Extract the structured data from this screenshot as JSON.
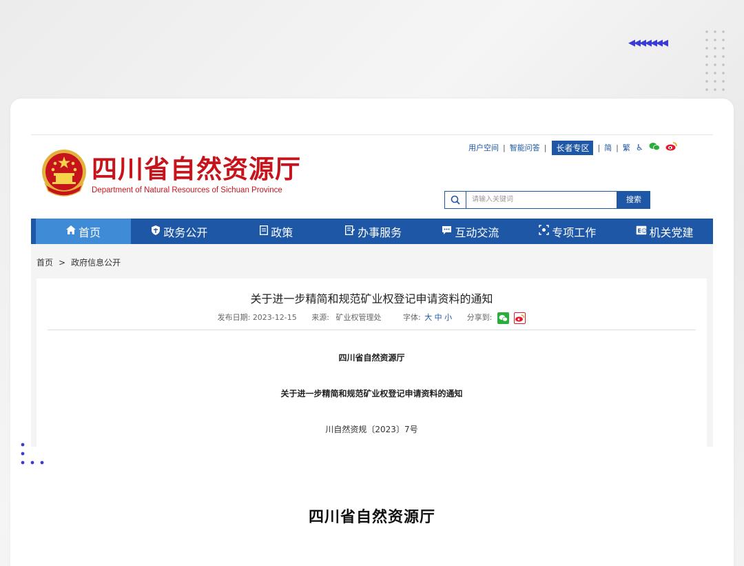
{
  "header": {
    "site_title": "四川省自然资源厅",
    "site_subtitle": "Department of Natural Resources of Sichuan Province",
    "links": [
      "用户空间",
      "智能问答",
      "长者专区"
    ],
    "lang_simplified": "简",
    "lang_traditional": "繁",
    "search_placeholder": "请输入关键词",
    "search_button": "搜索"
  },
  "nav": {
    "items": [
      {
        "label": "首页",
        "icon": "home-icon"
      },
      {
        "label": "政务公开",
        "icon": "shield-icon"
      },
      {
        "label": "政策",
        "icon": "document-icon"
      },
      {
        "label": "办事服务",
        "icon": "form-icon"
      },
      {
        "label": "互动交流",
        "icon": "chat-icon"
      },
      {
        "label": "专项工作",
        "icon": "target-icon"
      },
      {
        "label": "机关党建",
        "icon": "party-icon"
      }
    ]
  },
  "breadcrumb": {
    "home": "首页",
    "separator": ">",
    "current": "政府信息公开"
  },
  "article": {
    "title": "关于进一步精简和规范矿业权登记申请资料的通知",
    "date_label": "发布日期:",
    "date": "2023-12-15",
    "source_label": "来源:",
    "source": "矿业权管理处",
    "font_label": "字体:",
    "font_sizes": "大 中 小",
    "share_label": "分享到:",
    "org": "四川省自然资源厅",
    "subtitle": "关于进一步精简和规范矿业权登记申请资料的通知",
    "doc_number": "川自然资规〔2023〕7号"
  },
  "overlay": {
    "org_large": "四川省自然资源厅"
  },
  "colors": {
    "brand_red": "#c7141c",
    "brand_blue": "#1d57a6",
    "nav_active": "#3f8bd6",
    "accent_violet": "#3a3ad6"
  }
}
